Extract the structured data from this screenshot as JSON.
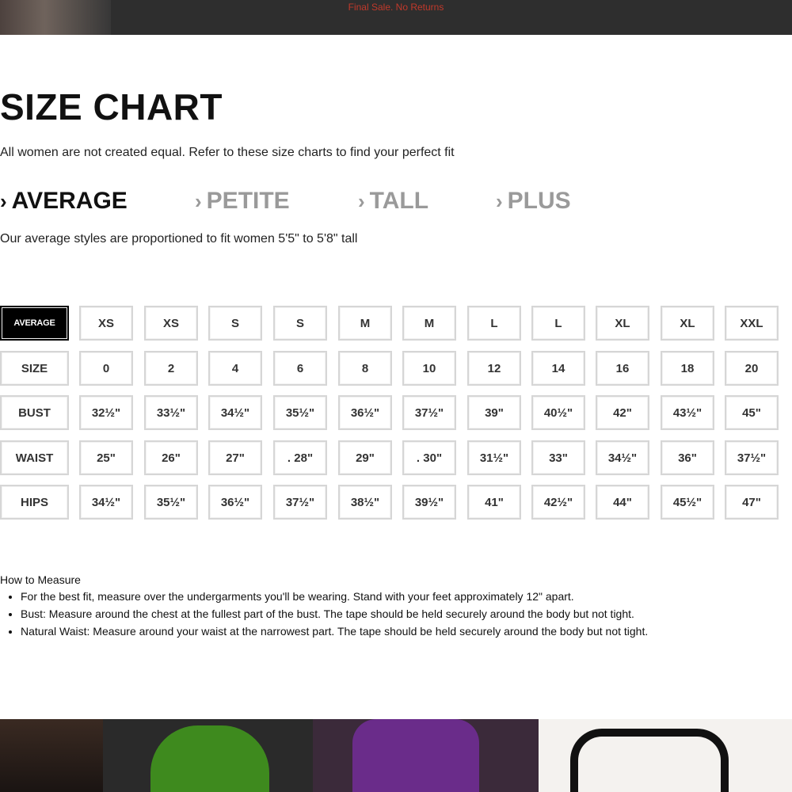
{
  "topbar": {
    "promo": "Final Sale. No Returns"
  },
  "title": "SIZE CHART",
  "intro": "All women are not created equal. Refer to these size charts to find your perfect fit",
  "tabs": [
    {
      "label": "AVERAGE",
      "active": true
    },
    {
      "label": "PETITE",
      "active": false
    },
    {
      "label": "TALL",
      "active": false
    },
    {
      "label": "PLUS",
      "active": false
    }
  ],
  "tab_description": "Our average styles are proportioned to fit women 5'5\" to 5'8\" tall",
  "table": {
    "corner": "AVERAGE",
    "letters": [
      "XS",
      "XS",
      "S",
      "S",
      "M",
      "M",
      "L",
      "L",
      "XL",
      "XL",
      "XXL"
    ],
    "rows": [
      {
        "label": "SIZE",
        "values": [
          "0",
          "2",
          "4",
          "6",
          "8",
          "10",
          "12",
          "14",
          "16",
          "18",
          "20"
        ]
      },
      {
        "label": "BUST",
        "values": [
          "32½\"",
          "33½\"",
          "34½\"",
          "35½\"",
          "36½\"",
          "37½\"",
          "39\"",
          "40½\"",
          "42\"",
          "43½\"",
          "45\""
        ]
      },
      {
        "label": "WAIST",
        "values": [
          "25\"",
          "26\"",
          "27\"",
          ". 28\"",
          "29\"",
          ". 30\"",
          "31½\"",
          "33\"",
          "34½\"",
          "36\"",
          "37½\""
        ]
      },
      {
        "label": "HIPS",
        "values": [
          "34½\"",
          "35½\"",
          "36½\"",
          "37½\"",
          "38½\"",
          "39½\"",
          "41\"",
          "42½\"",
          "44\"",
          "45½\"",
          "47\""
        ]
      }
    ]
  },
  "how_to_measure": {
    "heading": "How to Measure",
    "items": [
      "For the best fit, measure over the undergarments you'll be wearing. Stand with your feet approximately 12\" apart.",
      "Bust: Measure around the chest at the fullest part of the bust. The tape should be held securely around the body but not tight.",
      "Natural Waist: Measure around your waist at the narrowest part. The tape should be held securely around the body but not tight."
    ]
  }
}
